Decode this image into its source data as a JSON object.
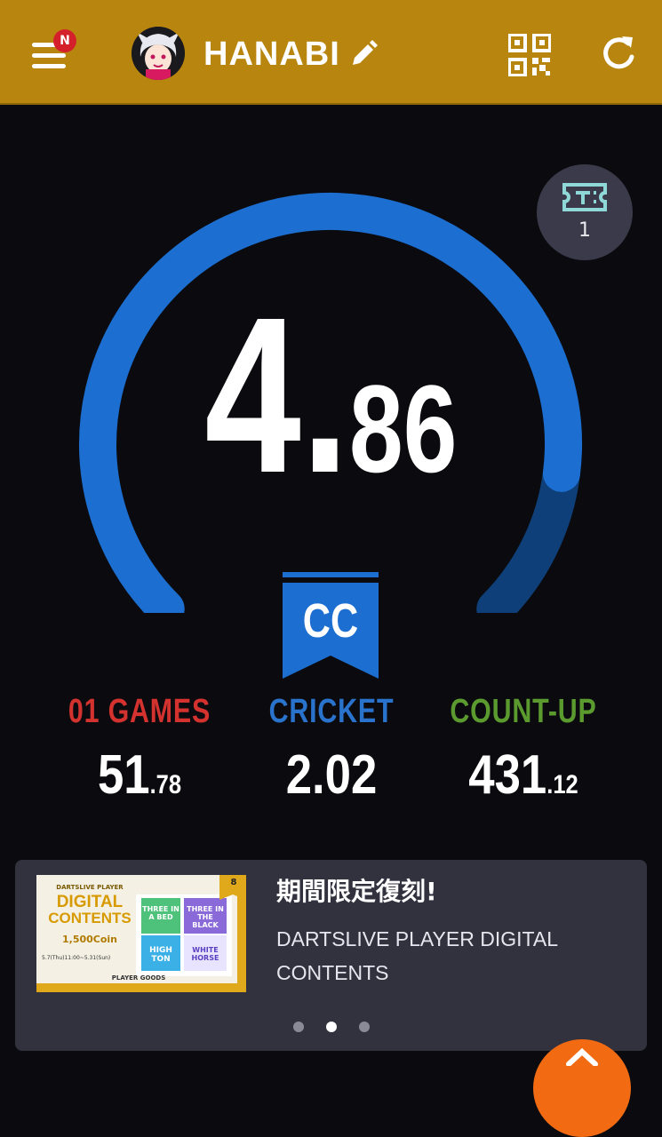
{
  "header": {
    "menu_badge": "N",
    "username": "HANABI",
    "icons": {
      "menu": "hamburger-menu-icon",
      "edit": "pencil-icon",
      "qr": "qr-code-icon",
      "refresh": "refresh-icon"
    },
    "background_color": "#b8860f"
  },
  "rating": {
    "integer": "4",
    "dot": ".",
    "decimal": "86",
    "gauge_progress": 0.86,
    "gauge_color": "#1c6fd1",
    "gauge_remaining_color": "#0f3f78"
  },
  "ticket": {
    "icon": "ticket-icon",
    "count": "1"
  },
  "class": {
    "label": "CC",
    "color": "#1c6fd1"
  },
  "stats": [
    {
      "name": "01 GAMES",
      "value_int": "51",
      "value_dec": ".78",
      "color": "#d3322f"
    },
    {
      "name": "CRICKET",
      "value_int": "2.02",
      "value_dec": "",
      "color": "#2a73cc"
    },
    {
      "name": "COUNT-UP",
      "value_int": "431",
      "value_dec": ".12",
      "color": "#5a9a2e"
    }
  ],
  "promo": {
    "title": "期間限定復刻!",
    "description": "DARTSLIVE PLAYER DIGITAL CONTENTS",
    "image": {
      "heading_small": "DARTSLIVE PLAYER",
      "heading_big_1": "DIGITAL",
      "heading_big_2": "CONTENTS",
      "price": "1,500Coin",
      "period": "5.7(Thu)11:00~5.31(Sun)",
      "count": "8",
      "tiles": [
        "THREE IN A BED",
        "THREE IN THE BLACK",
        "HIGH TON",
        "WHITE HORSE"
      ],
      "footer": "PLAYER GOODS"
    },
    "carousel_active_index": 1,
    "carousel_count": 3
  }
}
